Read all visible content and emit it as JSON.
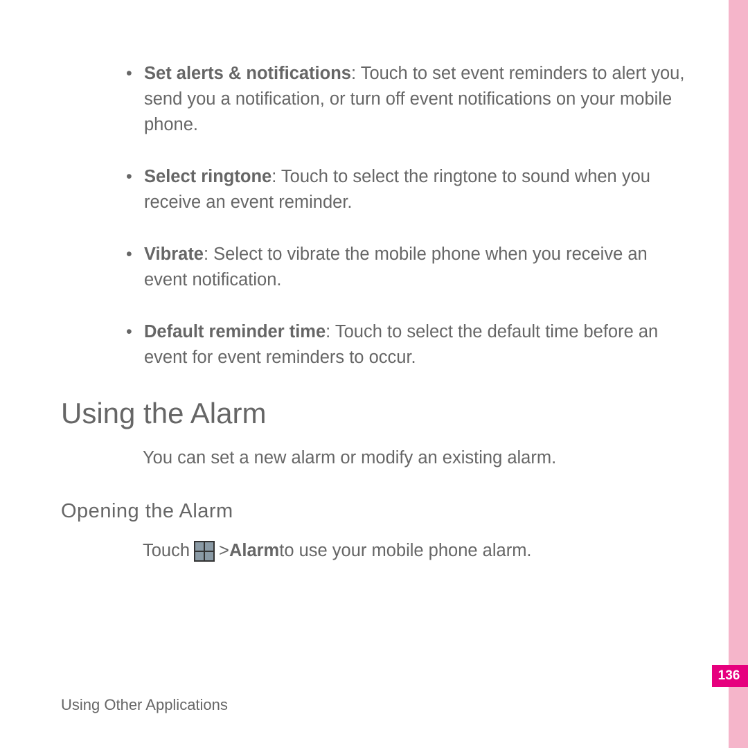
{
  "bullets": [
    {
      "term": "Set alerts & notifications",
      "desc": ": Touch to set event reminders to alert you, send you a notification, or turn off event notifications on your mobile phone."
    },
    {
      "term": "Select ringtone",
      "desc": ": Touch to select the ringtone to sound when you receive an event reminder."
    },
    {
      "term": "Vibrate",
      "desc": ": Select to vibrate the mobile phone when you receive an event notification."
    },
    {
      "term": "Default reminder time",
      "desc": ": Touch to select the default time before an event for event reminders to occur."
    }
  ],
  "heading": "Using the Alarm",
  "intro": "You can set a new alarm or modify an existing alarm.",
  "subheading": "Opening the Alarm",
  "instruction": {
    "pre": "Touch ",
    "mid": " > ",
    "bold": "Alarm",
    "post": " to use your mobile phone alarm."
  },
  "footer": "Using Other Applications",
  "page_number": "136"
}
